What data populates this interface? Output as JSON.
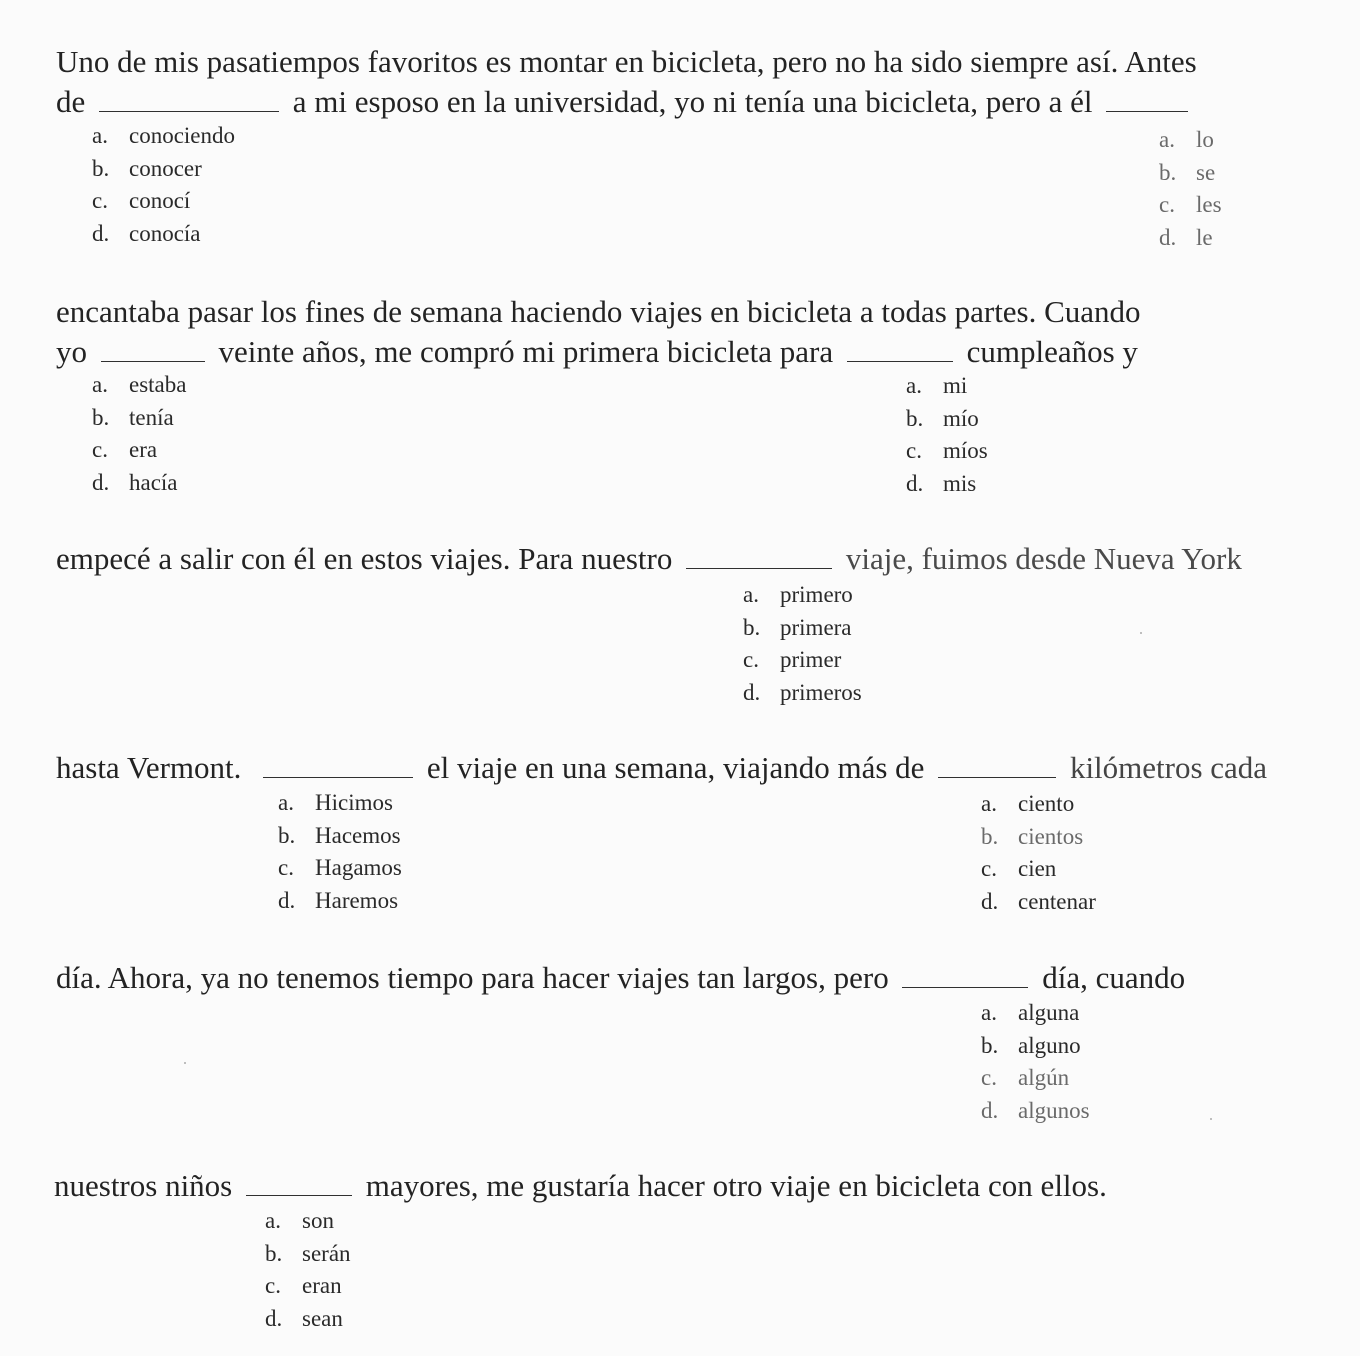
{
  "paragraph": {
    "l1": {
      "t1": "Uno de mis pasatiempos favoritos es montar en bicicleta, pero no ha sido siempre así.  Antes"
    },
    "l2": {
      "t1": "de",
      "t2": "a mi esposo en la universidad, yo ni tenía una bicicleta, pero a él"
    },
    "l3": {
      "t1": "encantaba pasar los fines de semana haciendo viajes en bicicleta a todas partes.  Cuando"
    },
    "l4": {
      "t1": "yo",
      "t2": "veinte años, me compró mi primera bicicleta para",
      "t3": "cumpleaños y"
    },
    "l5": {
      "t1": "empecé a salir con él en estos viajes.  Para nuestro",
      "t2": "viaje, fuimos desde Nueva York"
    },
    "l6": {
      "t1": "hasta Vermont.",
      "t2": "el viaje en una semana, viajando más de",
      "t3": "kilómetros cada"
    },
    "l7": {
      "t1": "día.  Ahora,  ya no tenemos tiempo para hacer viajes tan largos, pero",
      "t2": "día, cuando"
    },
    "l8": {
      "t1": "nuestros niños",
      "t2": "mayores, me gustaría hacer otro viaje en bicicleta con ellos."
    }
  },
  "questions": [
    {
      "id": 1,
      "options": [
        {
          "letter": "a.",
          "text": "conociendo"
        },
        {
          "letter": "b.",
          "text": "conocer"
        },
        {
          "letter": "c.",
          "text": "conocí"
        },
        {
          "letter": "d.",
          "text": "conocía"
        }
      ]
    },
    {
      "id": 2,
      "options": [
        {
          "letter": "a.",
          "text": "lo"
        },
        {
          "letter": "b.",
          "text": "se"
        },
        {
          "letter": "c.",
          "text": "les"
        },
        {
          "letter": "d.",
          "text": "le"
        }
      ]
    },
    {
      "id": 3,
      "options": [
        {
          "letter": "a.",
          "text": "estaba"
        },
        {
          "letter": "b.",
          "text": "tenía"
        },
        {
          "letter": "c.",
          "text": "era"
        },
        {
          "letter": "d.",
          "text": "hacía"
        }
      ]
    },
    {
      "id": 4,
      "options": [
        {
          "letter": "a.",
          "text": "mi"
        },
        {
          "letter": "b.",
          "text": "mío"
        },
        {
          "letter": "c.",
          "text": "míos"
        },
        {
          "letter": "d.",
          "text": "mis"
        }
      ]
    },
    {
      "id": 5,
      "options": [
        {
          "letter": "a.",
          "text": "primero"
        },
        {
          "letter": "b.",
          "text": "primera"
        },
        {
          "letter": "c.",
          "text": "primer"
        },
        {
          "letter": "d.",
          "text": "primeros"
        }
      ]
    },
    {
      "id": 6,
      "options": [
        {
          "letter": "a.",
          "text": "Hicimos"
        },
        {
          "letter": "b.",
          "text": "Hacemos"
        },
        {
          "letter": "c.",
          "text": "Hagamos"
        },
        {
          "letter": "d.",
          "text": "Haremos"
        }
      ]
    },
    {
      "id": 7,
      "options": [
        {
          "letter": "a.",
          "text": "ciento"
        },
        {
          "letter": "b.",
          "text": "cientos"
        },
        {
          "letter": "c.",
          "text": "cien"
        },
        {
          "letter": "d.",
          "text": "centenar"
        }
      ]
    },
    {
      "id": 8,
      "options": [
        {
          "letter": "a.",
          "text": "alguna"
        },
        {
          "letter": "b.",
          "text": "alguno"
        },
        {
          "letter": "c.",
          "text": "algún"
        },
        {
          "letter": "d.",
          "text": "algunos"
        }
      ]
    },
    {
      "id": 9,
      "options": [
        {
          "letter": "a.",
          "text": "son"
        },
        {
          "letter": "b.",
          "text": "serán"
        },
        {
          "letter": "c.",
          "text": "eran"
        },
        {
          "letter": "d.",
          "text": "sean"
        }
      ]
    }
  ]
}
